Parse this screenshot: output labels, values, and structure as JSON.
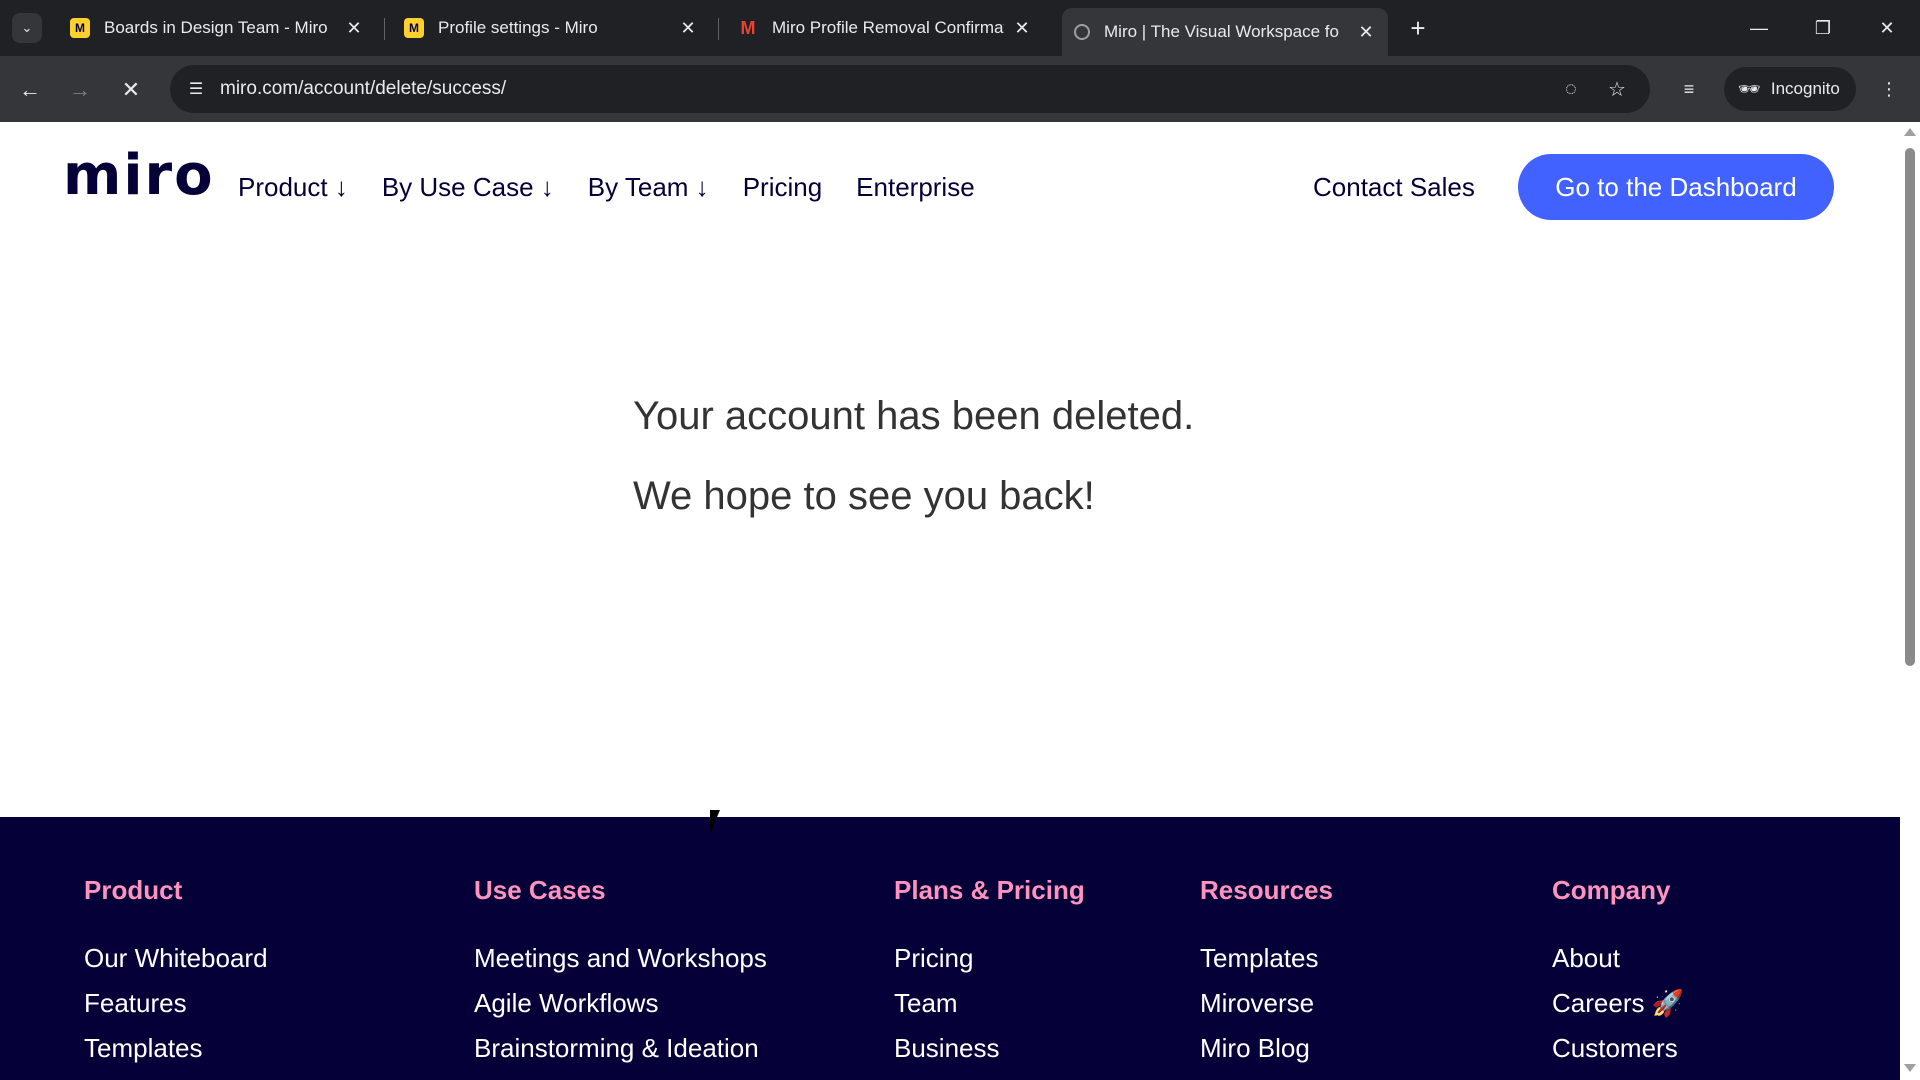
{
  "browser": {
    "tabs": [
      {
        "title": "Boards in Design Team - Miro",
        "favicon": "miro-icon"
      },
      {
        "title": "Profile settings - Miro",
        "favicon": "miro-icon"
      },
      {
        "title": "Miro Profile Removal Confirmat",
        "favicon": "gmail-icon"
      },
      {
        "title": "Miro | The Visual Workspace fo",
        "favicon": "loading-icon"
      }
    ],
    "url": "miro.com/account/delete/success/",
    "incognito_label": "Incognito"
  },
  "header": {
    "logo": "miro",
    "nav": [
      "Product ↓",
      "By Use Case ↓",
      "By Team ↓",
      "Pricing",
      "Enterprise"
    ],
    "contact_sales": "Contact Sales",
    "cta": "Go to the Dashboard"
  },
  "main": {
    "line1": "Your account has been deleted.",
    "line2": "We hope to see you back!"
  },
  "footer": {
    "columns": [
      {
        "heading": "Product",
        "links": [
          "Our Whiteboard",
          "Features",
          "Templates"
        ]
      },
      {
        "heading": "Use Cases",
        "links": [
          "Meetings and Workshops",
          "Agile Workflows",
          "Brainstorming & Ideation"
        ]
      },
      {
        "heading": "Plans & Pricing",
        "links": [
          "Pricing",
          "Team",
          "Business"
        ]
      },
      {
        "heading": "Resources",
        "links": [
          "Templates",
          "Miroverse",
          "Miro Blog"
        ]
      },
      {
        "heading": "Company",
        "links": [
          "About",
          "Careers 🚀",
          "Customers"
        ]
      }
    ]
  },
  "colors": {
    "brand_dark": "#050038",
    "cta_blue": "#4262ff",
    "footer_heading": "#ff93bd"
  }
}
